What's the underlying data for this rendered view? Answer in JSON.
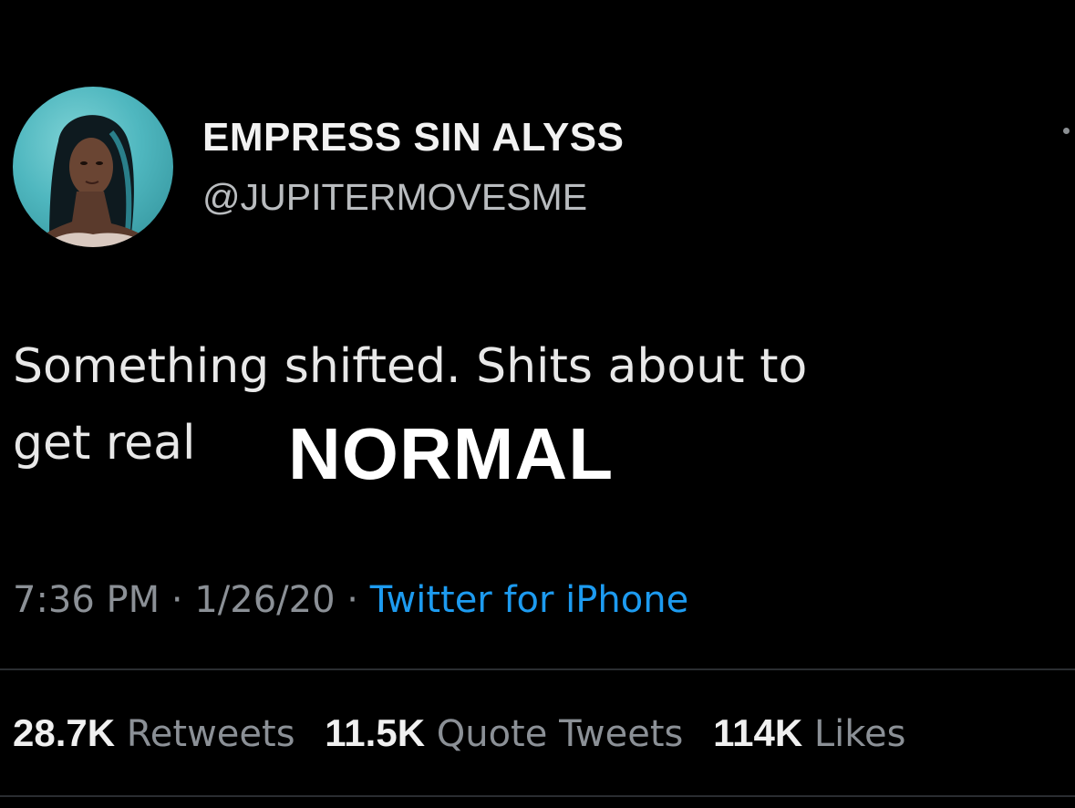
{
  "user": {
    "display_name": "EMPRESS SIN ALYSS",
    "handle": "@JUPITERMOVESME",
    "avatar_icon": "user-avatar-photo"
  },
  "tweet": {
    "line1": "Something shifted. Shits about to",
    "line2": "get real",
    "overlay_word": "NORMAL"
  },
  "meta": {
    "time": "7:36 PM",
    "sep1": " · ",
    "date": "1/26/20",
    "sep2": " · ",
    "source": "Twitter for iPhone"
  },
  "stats": {
    "retweets_count": "28.7K",
    "retweets_label": "Retweets",
    "quote_count": "11.5K",
    "quote_label": "Quote Tweets",
    "likes_count": "114K",
    "likes_label": "Likes"
  },
  "colors": {
    "background": "#000000",
    "link": "#1d9bf0",
    "muted": "#8b9096"
  }
}
